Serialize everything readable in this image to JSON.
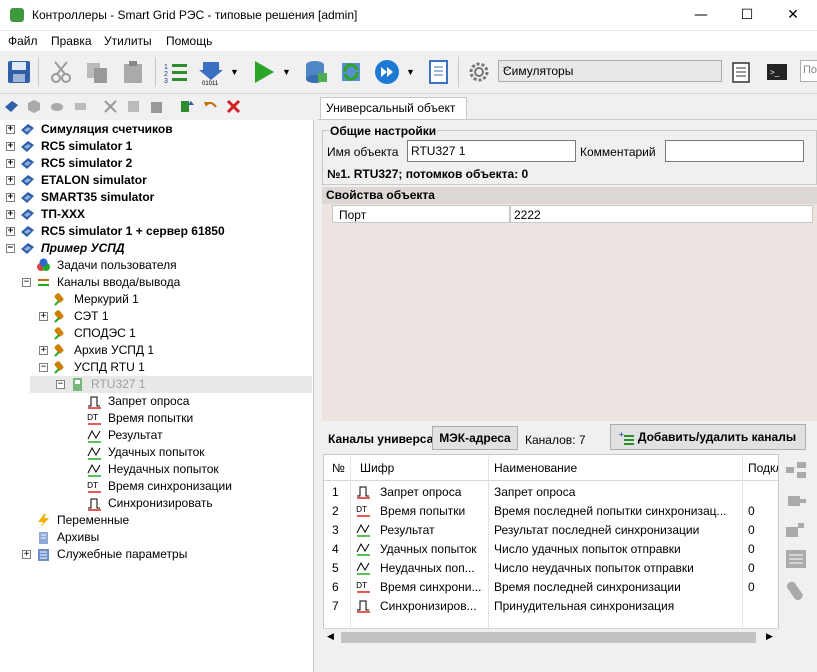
{
  "window": {
    "title": "Контроллеры - Smart Grid РЭС - типовые решения [admin]",
    "minimize": "—",
    "maximize": "☐",
    "close": "✕"
  },
  "menu": [
    {
      "label": "Файл"
    },
    {
      "label": "Правка"
    },
    {
      "label": "Утилиты"
    },
    {
      "label": "Помощь"
    }
  ],
  "toolbar": {
    "combo_value": "Симуляторы",
    "search_placeholder": "По"
  },
  "tree": {
    "items": [
      {
        "label": "Симуляция счетчиков"
      },
      {
        "label": "RC5 simulator 1"
      },
      {
        "label": "RC5 simulator 2"
      },
      {
        "label": "ETALON simulator"
      },
      {
        "label": "SMART35 simulator"
      },
      {
        "label": "ТП-XXX"
      },
      {
        "label": "RC5 simulator 1 + сервер 61850"
      },
      {
        "label": "Пример УСПД"
      },
      {
        "label": "Задачи пользователя"
      },
      {
        "label": "Каналы ввода/вывода"
      },
      {
        "label": "Меркурий 1"
      },
      {
        "label": "СЭТ 1"
      },
      {
        "label": "СПОДЭС 1"
      },
      {
        "label": "Архив УСПД 1"
      },
      {
        "label": "УСПД RTU 1"
      },
      {
        "label": "RTU327 1"
      },
      {
        "label": "Запрет опроса"
      },
      {
        "label": "Время попытки"
      },
      {
        "label": "Результат"
      },
      {
        "label": "Удачных попыток"
      },
      {
        "label": "Неудачных попыток"
      },
      {
        "label": "Время синхронизации"
      },
      {
        "label": "Синхронизировать"
      },
      {
        "label": "Переменные"
      },
      {
        "label": "Архивы"
      },
      {
        "label": "Служебные параметры"
      }
    ]
  },
  "tab": {
    "label": "Универсальный объект"
  },
  "general": {
    "title": "Общие настройки",
    "name_label": "Имя объекта",
    "name_value": "RTU327 1",
    "comment_label": "Комментарий",
    "comment_value": "",
    "info": "№1. RTU327; потомков объекта: 0"
  },
  "props": {
    "title": "Свойства объекта",
    "rows": [
      {
        "name": "Порт",
        "value": "2222"
      }
    ]
  },
  "channels": {
    "tab_label": "Каналы универса",
    "mek_button": "МЭК-адреса",
    "count_text": "Каналов: 7",
    "add_button": "Добавить/удалить каналы",
    "columns": [
      "№",
      "Шифр",
      "Наименование",
      "Подкл"
    ],
    "rows": [
      {
        "n": "1",
        "code": "Запрет опроса",
        "name": "Запрет опроса",
        "conn": ""
      },
      {
        "n": "2",
        "code": "Время попытки",
        "name": "Время последней попытки синхронизац...",
        "conn": "0"
      },
      {
        "n": "3",
        "code": "Результат",
        "name": "Результат последней синхронизации",
        "conn": "0"
      },
      {
        "n": "4",
        "code": "Удачных попыток",
        "name": "Число удачных попыток отправки",
        "conn": "0"
      },
      {
        "n": "5",
        "code": "Неудачных поп...",
        "name": "Число неудачных попыток отправки",
        "conn": "0"
      },
      {
        "n": "6",
        "code": "Время синхрони...",
        "name": "Время последней синхронизации",
        "conn": "0"
      },
      {
        "n": "7",
        "code": "Синхронизиров...",
        "name": "Принудительная синхронизация",
        "conn": ""
      }
    ]
  }
}
